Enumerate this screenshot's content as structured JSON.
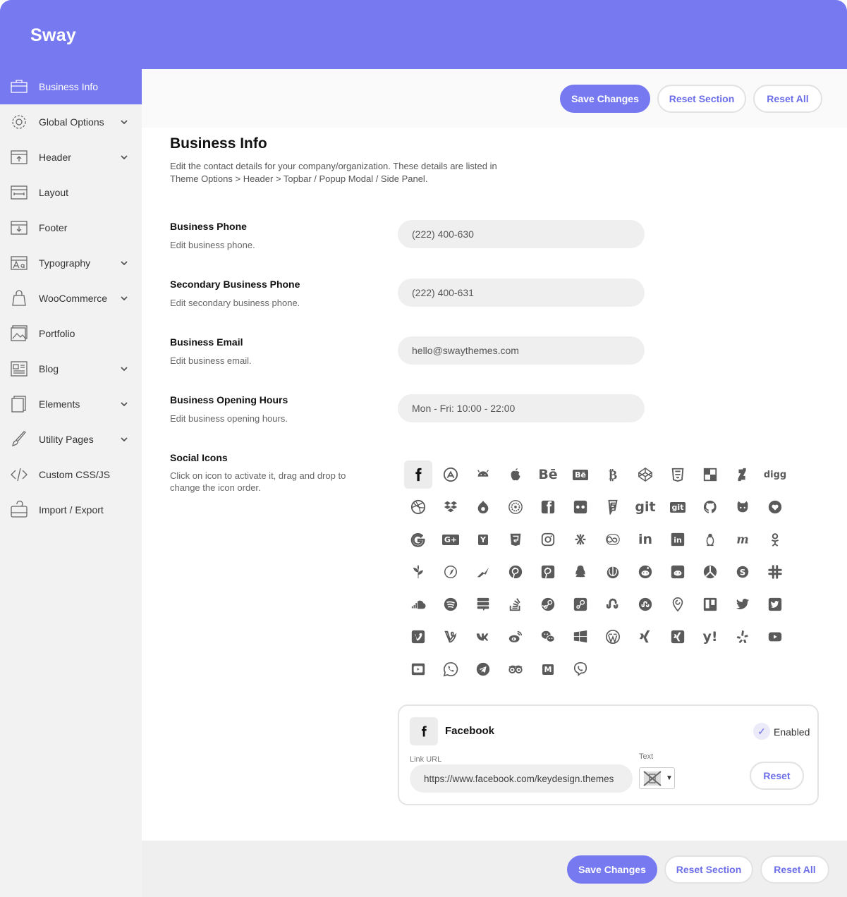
{
  "app": {
    "brand": "Sway"
  },
  "sidebar": {
    "items": [
      {
        "label": "Business Info",
        "icon": "briefcase-icon",
        "has_submenu": false,
        "active": true
      },
      {
        "label": "Global Options",
        "icon": "gear-icon",
        "has_submenu": true
      },
      {
        "label": "Header",
        "icon": "header-layout-icon",
        "has_submenu": true
      },
      {
        "label": "Layout",
        "icon": "layout-width-icon",
        "has_submenu": false
      },
      {
        "label": "Footer",
        "icon": "footer-layout-icon",
        "has_submenu": false
      },
      {
        "label": "Typography",
        "icon": "typography-icon",
        "has_submenu": true
      },
      {
        "label": "WooCommerce",
        "icon": "shopping-bag-icon",
        "has_submenu": true
      },
      {
        "label": "Portfolio",
        "icon": "image-gallery-icon",
        "has_submenu": false
      },
      {
        "label": "Blog",
        "icon": "newspaper-icon",
        "has_submenu": true
      },
      {
        "label": "Elements",
        "icon": "elements-icon",
        "has_submenu": true
      },
      {
        "label": "Utility Pages",
        "icon": "brush-icon",
        "has_submenu": true
      },
      {
        "label": "Custom CSS/JS",
        "icon": "code-icon",
        "has_submenu": false
      },
      {
        "label": "Import / Export",
        "icon": "import-export-icon",
        "has_submenu": false
      }
    ]
  },
  "toolbar": {
    "save_label": "Save Changes",
    "reset_section_label": "Reset Section",
    "reset_all_label": "Reset All"
  },
  "section": {
    "title": "Business Info",
    "description": "Edit the contact details for your company/organization. These details are listed in Theme Options > Header > Topbar / Popup Modal / Side Panel."
  },
  "fields": [
    {
      "label": "Business Phone",
      "desc": "Edit business phone.",
      "value": "(222) 400-630"
    },
    {
      "label": "Secondary Business Phone",
      "desc": "Edit secondary business phone.",
      "value": "(222) 400-631"
    },
    {
      "label": "Business Email",
      "desc": "Edit business email.",
      "value": "hello@swaythemes.com"
    },
    {
      "label": "Business Opening Hours",
      "desc": "Edit business opening hours.",
      "value": "Mon - Fri: 10:00 - 22:00"
    }
  ],
  "social": {
    "label": "Social Icons",
    "desc": "Click on icon to activate it, drag and drop to change the icon order.",
    "icons": [
      "facebook-icon",
      "app-store-icon",
      "android-icon",
      "apple-icon",
      "behance-icon",
      "behance-square-icon",
      "bitcoin-icon",
      "codepen-icon",
      "css3-icon",
      "delicious-icon",
      "deviantart-icon",
      "digg-icon",
      "dribbble-icon",
      "dropbox-icon",
      "drupal-icon",
      "empire-icon",
      "facebook-square-icon",
      "flickr-icon",
      "foursquare-icon",
      "git-icon",
      "git-square-icon",
      "github-icon",
      "github-alt-icon",
      "gratipay-icon",
      "google-icon",
      "google-plus-icon",
      "hacker-news-icon",
      "html5-icon",
      "instagram-icon",
      "joomla-icon",
      "lastfm-icon",
      "linkedin-icon",
      "linkedin-square-icon",
      "linux-icon",
      "meetup-icon",
      "odnoklassniki-icon",
      "paypal-leaf-icon",
      "safari-icon",
      "pied-piper-icon",
      "pinterest-icon",
      "pinterest-square-icon",
      "qq-icon",
      "rebel-icon",
      "reddit-icon",
      "reddit-square-icon",
      "resistance-icon",
      "skype-icon",
      "slack-icon",
      "soundcloud-icon",
      "spotify-icon",
      "stack-exchange-icon",
      "stack-overflow-icon",
      "steam-icon",
      "steam-square-icon",
      "stumbleupon-icon",
      "stumbleupon-circle-icon",
      "periscope-icon",
      "trello-icon",
      "twitter-icon",
      "twitter-square-icon",
      "vimeo-icon",
      "vine-icon",
      "vk-icon",
      "weibo-icon",
      "wechat-icon",
      "windows-icon",
      "wordpress-icon",
      "xing-icon",
      "xing-square-icon",
      "yahoo-icon",
      "yelp-icon",
      "youtube-icon",
      "youtube-square-icon",
      "whatsapp-icon",
      "telegram-icon",
      "tripadvisor-icon",
      "medium-icon",
      "viber-icon"
    ],
    "icon_text": {
      "behance": "Bē",
      "behance_sq": "Bē",
      "git": "git",
      "git_sq": "git",
      "digg": "digg",
      "linkedin": "in",
      "yahoo": "y!",
      "google_plus": "G+",
      "hacker": "Y",
      "medium": "M"
    }
  },
  "facebook_card": {
    "title": "Facebook",
    "enabled_label": "Enabled",
    "link_label": "Link URL",
    "link_value": "https://www.facebook.com/keydesign.themes",
    "text_label": "Text",
    "reset_label": "Reset"
  },
  "colors": {
    "accent": "#7679f0",
    "sidebar_bg": "#f2f2f2",
    "input_bg": "#efefef"
  }
}
